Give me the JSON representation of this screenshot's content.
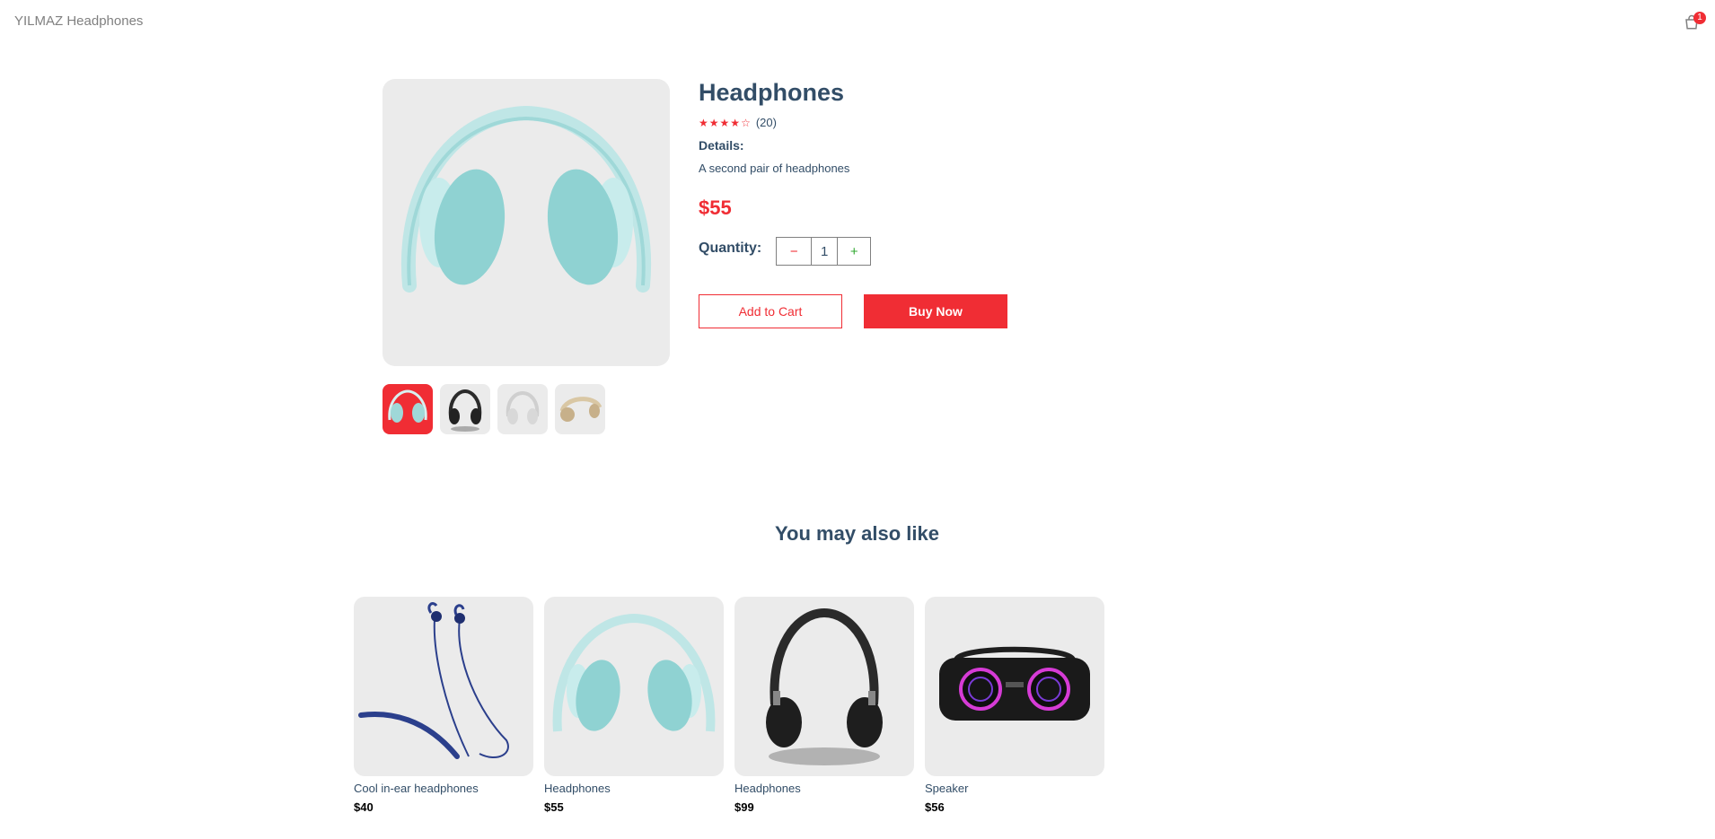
{
  "navbar": {
    "logo": "YILMAZ Headphones",
    "cart_count": "1"
  },
  "product": {
    "title": "Headphones",
    "stars_filled": 4,
    "stars_total": 5,
    "review_count": "(20)",
    "details_label": "Details:",
    "details_text": "A second pair of headphones",
    "price": "$55",
    "quantity_label": "Quantity:",
    "quantity_minus": "−",
    "quantity_value": "1",
    "quantity_plus": "+",
    "add_to_cart_label": "Add to Cart",
    "buy_now_label": "Buy Now",
    "thumbnails": [
      "teal headphones",
      "black headphones",
      "white headphones",
      "beige headphones"
    ],
    "selected_thumbnail": 0
  },
  "also_like": {
    "title": "You may also like",
    "items": [
      {
        "name": "Cool in-ear headphones",
        "price": "$40"
      },
      {
        "name": "Headphones",
        "price": "$55"
      },
      {
        "name": "Headphones",
        "price": "$99"
      },
      {
        "name": "Speaker",
        "price": "$56"
      }
    ]
  },
  "colors": {
    "accent": "#f02d34",
    "text": "#324d67",
    "card_bg": "#ebebeb"
  }
}
